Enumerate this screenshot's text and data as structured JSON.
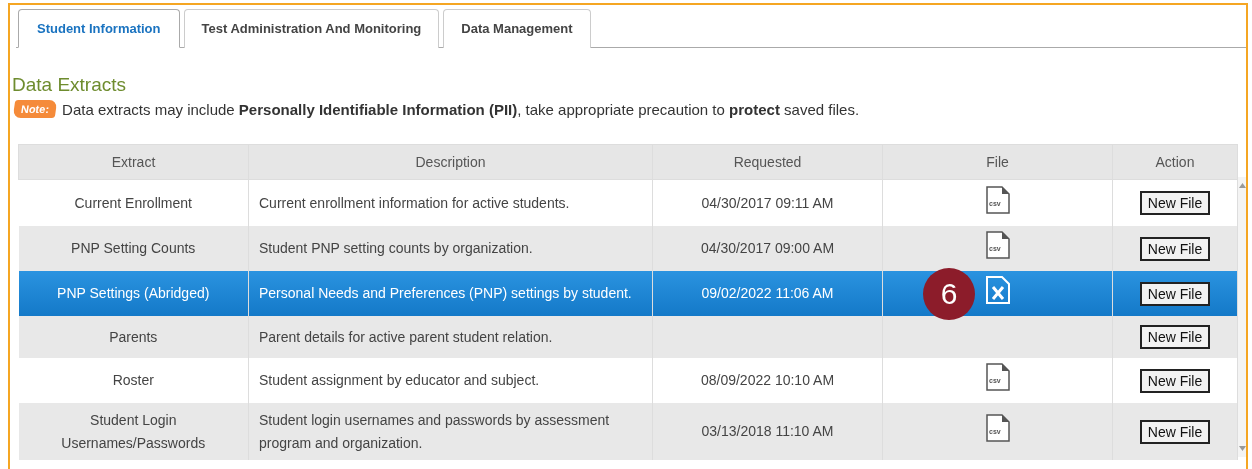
{
  "tabs": [
    {
      "label": "Student Information",
      "selected": true
    },
    {
      "label": "Test Administration And Monitoring",
      "selected": false
    },
    {
      "label": "Data Management",
      "selected": false
    }
  ],
  "title": "Data Extracts",
  "note": {
    "badge": "Note:",
    "text": "Data extracts may include **Personally Identifiable Information (PII)**, take appropriate precaution to **protect** saved files."
  },
  "table": {
    "columns": [
      "Extract",
      "Description",
      "Requested",
      "File",
      "Action"
    ],
    "rows": [
      {
        "extract": "Current Enrollment",
        "description": "Current enrollment information for active students.",
        "requested": "04/30/2017 09:11 AM",
        "file": {
          "kind": "csv",
          "label": "csv"
        },
        "action": "New File",
        "selected": false
      },
      {
        "extract": "PNP Setting Counts",
        "description": "Student PNP setting counts by organization.",
        "requested": "04/30/2017 09:00 AM",
        "file": {
          "kind": "csv",
          "label": "csv"
        },
        "action": "New File",
        "selected": false
      },
      {
        "extract": "PNP Settings (Abridged)",
        "description": "Personal Needs and Preferences (PNP) settings by student.",
        "requested": "09/02/2022 11:06 AM",
        "file": {
          "kind": "spreadsheet"
        },
        "action": "New File",
        "selected": true,
        "callout": "6"
      },
      {
        "extract": "Parents",
        "description": "Parent details for active parent student relation.",
        "action": "New File",
        "selected": false
      },
      {
        "extract": "Roster",
        "description": "Student assignment by educator and subject.",
        "requested": "08/09/2022 10:10 AM",
        "file": {
          "kind": "csv",
          "label": "csv"
        },
        "action": "New File",
        "selected": false
      },
      {
        "extract": "Student Login Usernames/Passwords",
        "description": "Student login usernames and passwords by assessment program and organization.",
        "requested": "03/13/2018 11:10 AM",
        "file": {
          "kind": "csv",
          "label": "csv"
        },
        "action": "New File",
        "selected": false
      }
    ]
  }
}
